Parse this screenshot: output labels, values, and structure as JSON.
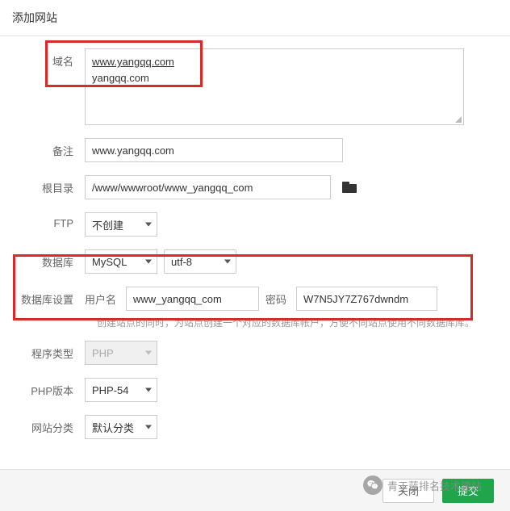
{
  "header": {
    "title": "添加网站"
  },
  "domain": {
    "label": "域名",
    "line1": "www.yangqq.com",
    "line2": "yangqq.com"
  },
  "remark": {
    "label": "备注",
    "value": "www.yangqq.com"
  },
  "root": {
    "label": "根目录",
    "value": "/www/wwwroot/www_yangqq_com"
  },
  "ftp": {
    "label": "FTP",
    "value": "不创建"
  },
  "db": {
    "label": "数据库",
    "engine": "MySQL",
    "charset": "utf-8"
  },
  "dbset": {
    "label": "数据库设置",
    "user_label": "用户名",
    "user_value": "www_yangqq_com",
    "pwd_label": "密码",
    "pwd_value": "W7N5JY7Z767dwndm",
    "hint": "创建站点的同时，为站点创建一个对应的数据库帐户，方便不同站点使用不同数据库库。"
  },
  "ptype": {
    "label": "程序类型",
    "value": "PHP"
  },
  "phpver": {
    "label": "PHP版本",
    "value": "PHP-54"
  },
  "cat": {
    "label": "网站分类",
    "value": "默认分类"
  },
  "footer": {
    "cancel": "关闭",
    "submit": "提交"
  },
  "overlay": {
    "text": "青于蓝排名技术建站"
  }
}
